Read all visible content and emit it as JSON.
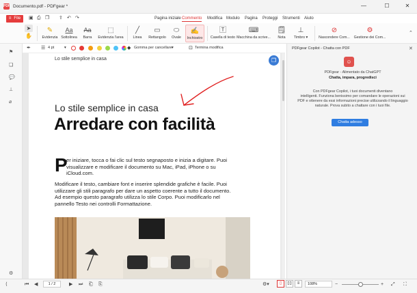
{
  "window": {
    "logo": "PDF",
    "title": "Documento.pdf - PDFgear *",
    "min": "—",
    "max": "☐",
    "close": "✕"
  },
  "menu": {
    "file_label": "File",
    "tabs": [
      {
        "label": "Pagina iniziale"
      },
      {
        "label": "Commento"
      },
      {
        "label": "Modifica"
      },
      {
        "label": "Modulo"
      },
      {
        "label": "Pagina"
      },
      {
        "label": "Proteggi"
      },
      {
        "label": "Strumenti"
      },
      {
        "label": "Aiuto"
      }
    ],
    "active_tab": "Commento"
  },
  "ribbon": {
    "tools": [
      {
        "label": "Evidenzia",
        "icon": "highlight-icon"
      },
      {
        "label": "Sottolinea",
        "icon": "underline-icon"
      },
      {
        "label": "Barra",
        "icon": "strikethrough-icon"
      },
      {
        "label": "Evidenzia l'area",
        "icon": "area-highlight-icon"
      },
      {
        "label": "Linea",
        "icon": "line-icon"
      },
      {
        "label": "Rettangolo",
        "icon": "rectangle-icon"
      },
      {
        "label": "Ovale",
        "icon": "oval-icon"
      },
      {
        "label": "Inchiostro",
        "icon": "ink-icon"
      },
      {
        "label": "Casella di testo",
        "icon": "textbox-icon"
      },
      {
        "label": "Macchina da scrive...",
        "icon": "typewriter-icon"
      },
      {
        "label": "Nota",
        "icon": "note-icon"
      },
      {
        "label": "Timbro",
        "icon": "stamp-icon"
      },
      {
        "label": "Nascondere Com...",
        "icon": "hide-comments-icon"
      },
      {
        "label": "Gestione dei Com...",
        "icon": "manage-comments-icon"
      }
    ],
    "active_tool": "Inchiostro"
  },
  "subtoolbar": {
    "stroke_width": "4 pt",
    "eraser_label": "Gomma per cancellare",
    "finish_label": "Termina modifica",
    "colors": [
      "#e53935",
      "#f39c12",
      "#f4d03f",
      "#9bd94a",
      "#4fc3f7",
      "#d6b0e8"
    ]
  },
  "document": {
    "running_head": "Lo stile semplice in casa",
    "subtitle": "Lo stile semplice in casa",
    "headline": "Arredare con facilità",
    "dropcap": "P",
    "para1_lines": [
      "er iniziare, tocca o fai clic sul testo segnaposto e inizia a digitare. Puoi",
      "visualizzare e modificare il documento su Mac, iPad, iPhone o su",
      "iCloud.com."
    ],
    "para2_lines": [
      "Modificare il testo, cambiare font e inserire splendide grafiche è facile. Puoi",
      "utilizzare gli stili paragrafo per dare un aspetto coerente a tutto il documento.",
      "Ad esempio questo paragrafo utilizza lo stile Corpo. Puoi modificarlo nel",
      "pannello Testo nei controlli Formattazione."
    ]
  },
  "copilot": {
    "title": "PDFgear Copilot - Chatta con PDF",
    "subtitle": "PDFgear - Alimentato da ChatGPT",
    "tagline": "Chatta, impara, progredisci",
    "description_lines": [
      "Con PDFgear Copilot, i tuoi documenti diventano",
      "intelligenti.  Funziona benissimo per comandare le operazioni sui",
      "PDF e ottenere da essi informazioni precise utilizzando il linguaggio",
      "naturale.  Prova subito a chattare con i tuoi file."
    ],
    "button": "Chatta adesso"
  },
  "status": {
    "page_value": "1 / 2",
    "zoom_value": "108%"
  }
}
